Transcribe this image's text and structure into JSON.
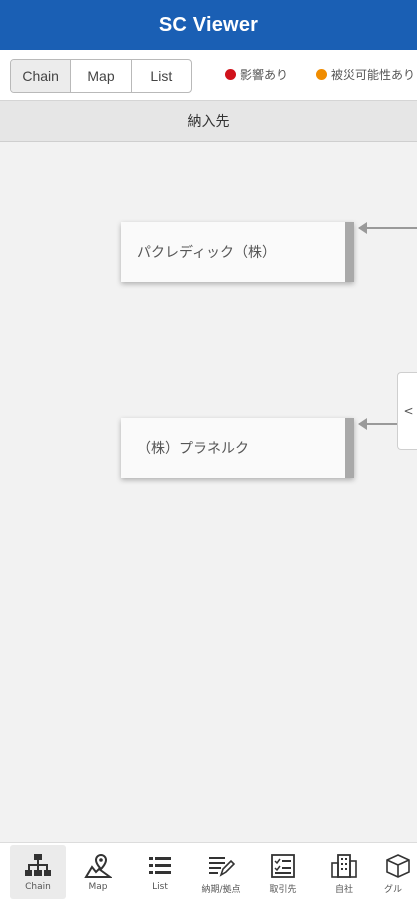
{
  "app": {
    "title": "SC Viewer"
  },
  "view_tabs": [
    {
      "label": "Chain",
      "active": true
    },
    {
      "label": "Map",
      "active": false
    },
    {
      "label": "List",
      "active": false
    }
  ],
  "legend": [
    {
      "label": "影響あり",
      "color": "#d0121b"
    },
    {
      "label": "被災可能性あり",
      "color": "#f08c00"
    }
  ],
  "column_header": "納入先",
  "nodes": [
    {
      "name": "パクレディック（株）"
    },
    {
      "name": "（株）プラネルク"
    }
  ],
  "side_handle": "<",
  "bottom_nav": [
    {
      "label": "Chain",
      "icon": "org-chart-icon",
      "active": true
    },
    {
      "label": "Map",
      "icon": "map-pin-icon",
      "active": false
    },
    {
      "label": "List",
      "icon": "list-icon",
      "active": false
    },
    {
      "label": "納期/拠点",
      "icon": "edit-list-icon",
      "active": false
    },
    {
      "label": "取引先",
      "icon": "checklist-icon",
      "active": false
    },
    {
      "label": "自社",
      "icon": "building-icon",
      "active": false
    },
    {
      "label": "グル",
      "icon": "cube-icon",
      "active": false
    }
  ],
  "colors": {
    "header_bg": "#1a5fb4",
    "canvas_bg": "#f2f2f2",
    "node_edge": "#a9a9a9"
  }
}
